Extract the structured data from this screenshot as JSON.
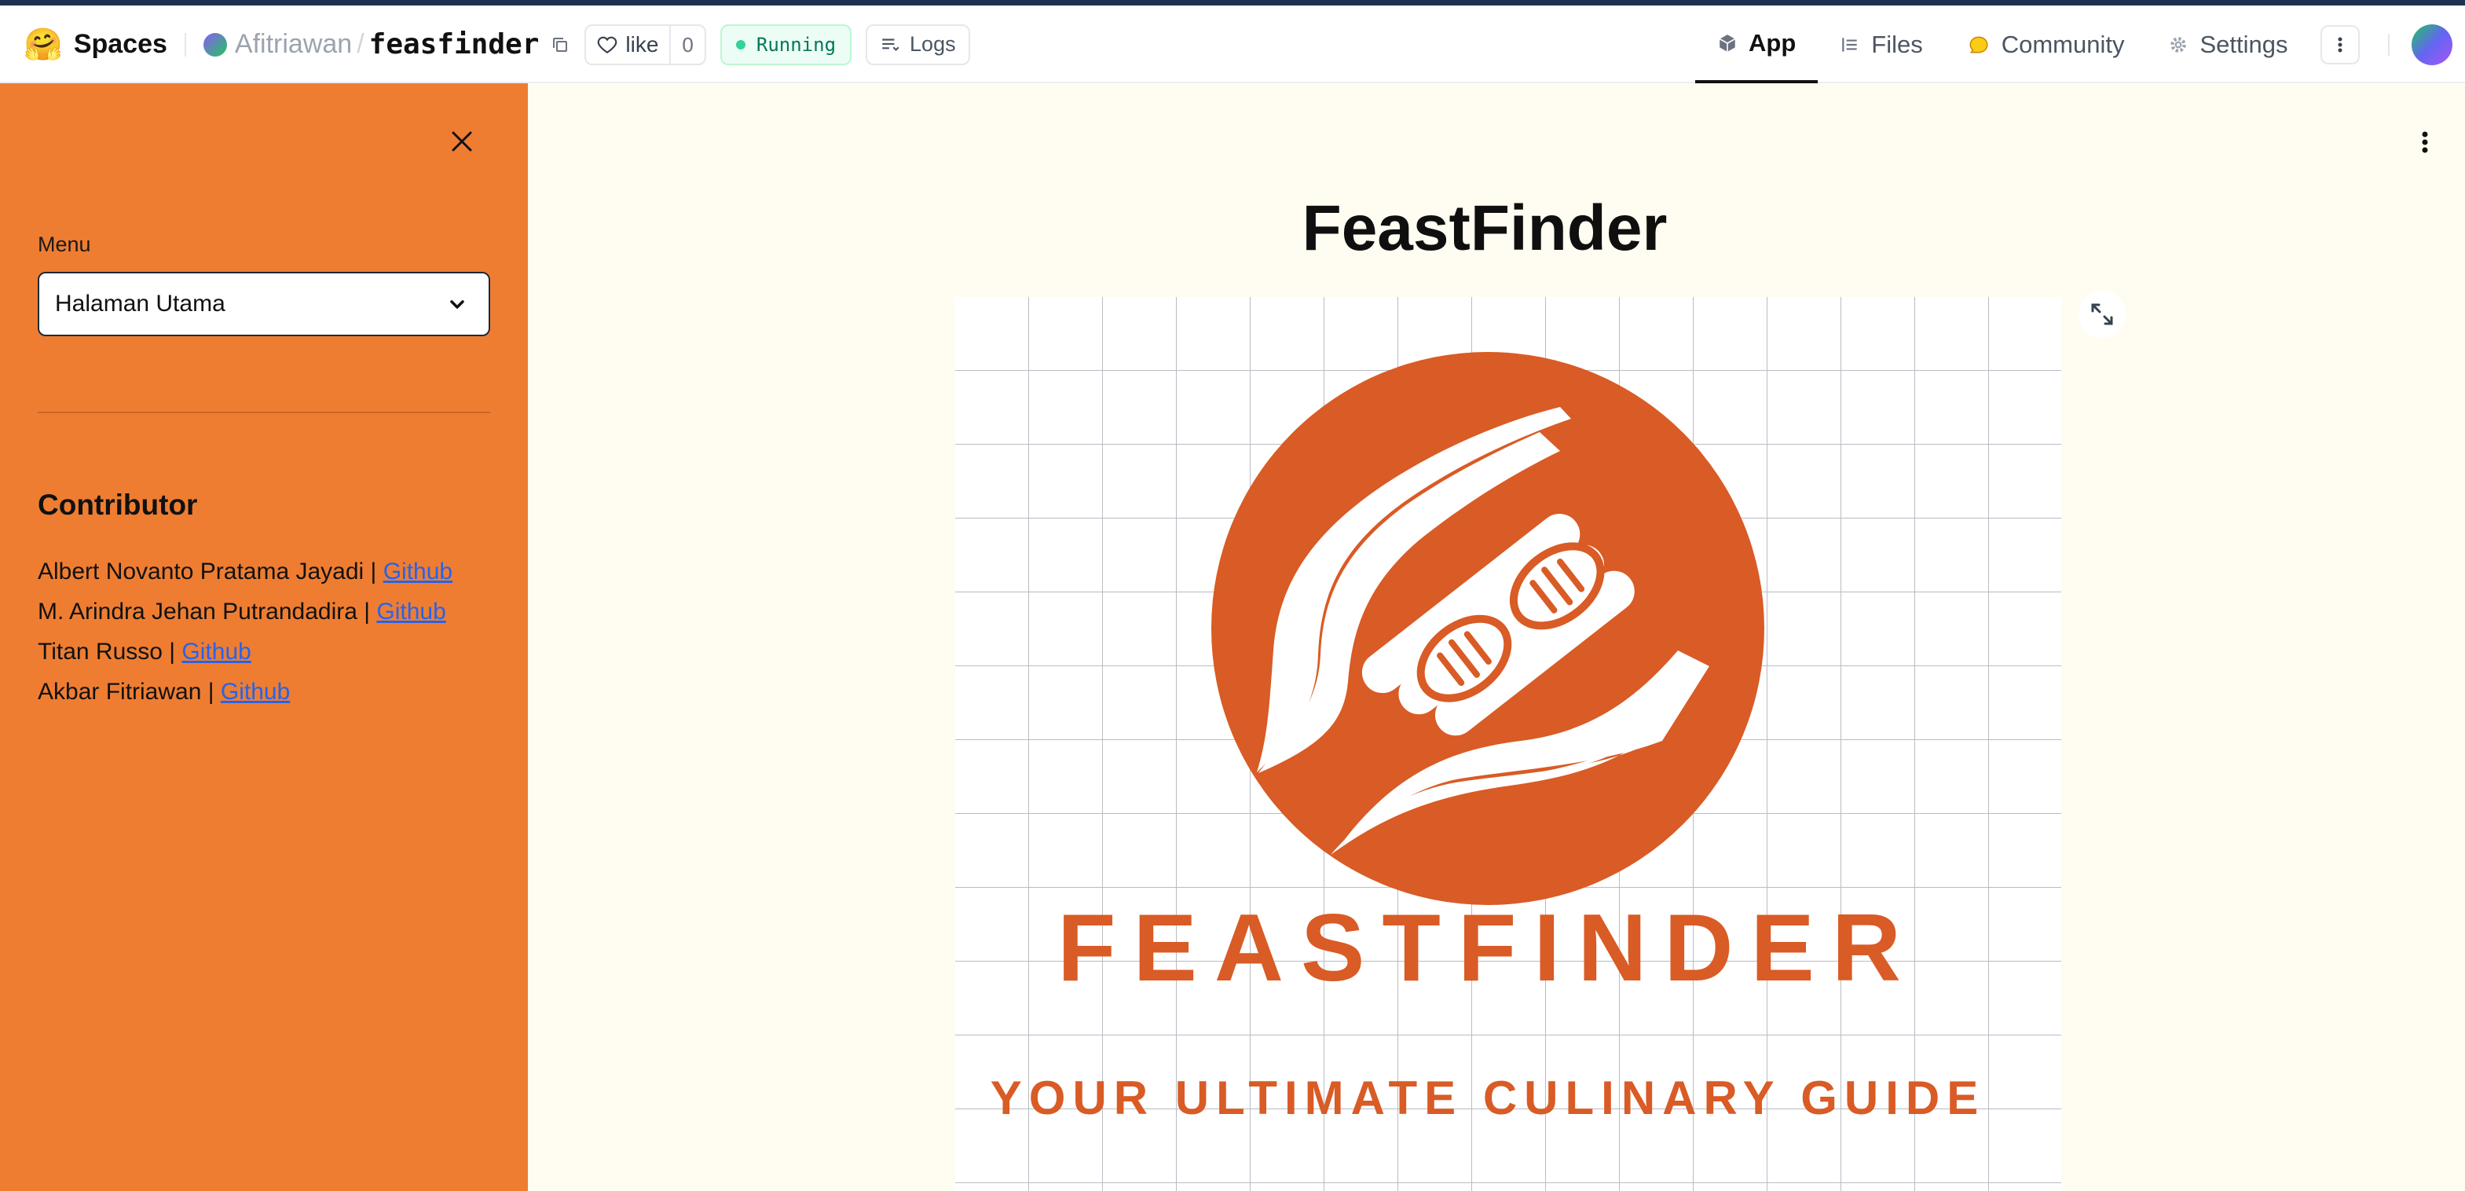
{
  "header": {
    "spaces_label": "Spaces",
    "owner": "Afitriawan",
    "separator": "/",
    "repo_name": "feasfinder",
    "like_label": "like",
    "like_count": "0",
    "status": "Running",
    "logs_label": "Logs",
    "tabs": [
      {
        "label": "App",
        "icon": "cube-icon",
        "active": true
      },
      {
        "label": "Files",
        "icon": "files-icon",
        "active": false
      },
      {
        "label": "Community",
        "icon": "community-icon",
        "active": false
      },
      {
        "label": "Settings",
        "icon": "gear-icon",
        "active": false
      }
    ]
  },
  "sidebar": {
    "menu_label": "Menu",
    "menu_selected": "Halaman Utama",
    "contributor_title": "Contributor",
    "contributors": [
      {
        "name": "Albert Novanto Pratama Jayadi | ",
        "link": "Github"
      },
      {
        "name": "M. Arindra Jehan Putrandadira | ",
        "link": "Github"
      },
      {
        "name": "Titan Russo | ",
        "link": "Github"
      },
      {
        "name": "Akbar Fitriawan | ",
        "link": "Github"
      }
    ]
  },
  "main": {
    "title": "FeastFinder",
    "logo": {
      "wordmark": "FEASTFINDER",
      "tagline": "YOUR ULTIMATE CULINARY GUIDE"
    }
  },
  "colors": {
    "sidebar_bg": "#ee7d32",
    "main_bg": "#fffdf1",
    "logo_orange": "#d95b25",
    "status_green": "#047857",
    "link_blue": "#2563eb"
  }
}
